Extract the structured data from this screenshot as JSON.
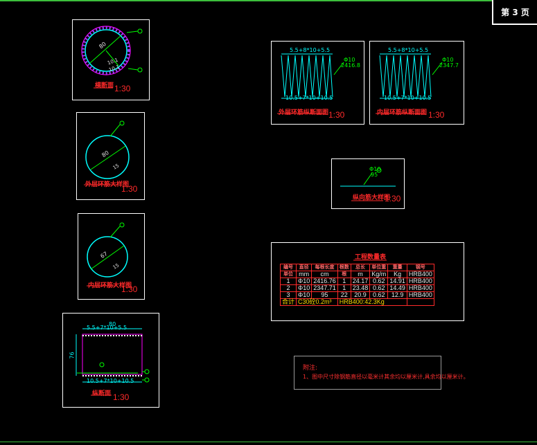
{
  "page": {
    "label": "第 3 页"
  },
  "cross_section": {
    "title": "横断面",
    "scale": "1:30",
    "dim_a": "80",
    "dim_b": "10.1",
    "dim_c": "10.1",
    "leaders": [
      "1",
      "0"
    ]
  },
  "outer_ring": {
    "title": "外层环筋大样图",
    "scale": "1:30",
    "dim_a": "80",
    "dim_b": "15",
    "leader": "1"
  },
  "inner_ring": {
    "title": "内层环筋大样图",
    "scale": "1:30",
    "dim_a": "67",
    "dim_b": "15",
    "leader": "2"
  },
  "longitudinal": {
    "title": "纵断面",
    "scale": "1:30",
    "width": "80",
    "height": "76",
    "top_dim": "5.5+7*10+5.5",
    "bottom_dim": "10.5+7*10+10.5",
    "leaders": [
      "1",
      "2",
      "3"
    ]
  },
  "outer_elev": {
    "title": "外层环筋纵断面图",
    "scale": "1:30",
    "top_dim": "5.5+8*10+5.5",
    "bottom_dim": "10.5+7*10+10.5",
    "spec_a": "Φ10",
    "spec_b": "2416.8",
    "leader": "1"
  },
  "inner_elev": {
    "title": "内层环筋纵断面图",
    "scale": "1:30",
    "top_dim": "5.5+8*10+5.5",
    "bottom_dim": "10.5+7*10+10.5",
    "spec_a": "Φ10",
    "spec_b": "2347.7",
    "leader": "2"
  },
  "longbar": {
    "title": "纵向筋大样图",
    "scale": "1:30",
    "spec_a": "Φ10",
    "spec_b": "95",
    "leader": "3"
  },
  "quantity_table": {
    "title": "工程数量表",
    "headers": [
      "编号",
      "直径",
      "每根长度",
      "根数",
      "总长",
      "单位重",
      "重量",
      "钢号"
    ],
    "units": [
      "mm",
      "cm",
      "根",
      "m",
      "Kg/m",
      "Kg",
      "HRB400"
    ],
    "units_label": "单位",
    "rows": [
      [
        "1",
        "Φ10",
        "2416.76",
        "1",
        "24.17",
        "0.62",
        "14.91",
        "HRB400"
      ],
      [
        "2",
        "Φ10",
        "2347.71",
        "1",
        "23.48",
        "0.62",
        "14.49",
        "HRB400"
      ],
      [
        "3",
        "Φ10",
        "95",
        "22",
        "20.9",
        "0.62",
        "12.9",
        "HRB400"
      ]
    ],
    "total_label": "合计",
    "total_concrete": "C30砼0.2m³",
    "total_steel": "HRB400:42.3Kg"
  },
  "notes": {
    "heading": "附注:",
    "line1": "1、图中尺寸除钢筋直径以毫米计其余均以厘米计,具余均以厘米计。"
  },
  "colors": {
    "cyan": "#00ffff",
    "red": "#ff2a2a",
    "green": "#00ff00",
    "magenta": "#ff00ff",
    "yellow": "#ffdd00"
  }
}
